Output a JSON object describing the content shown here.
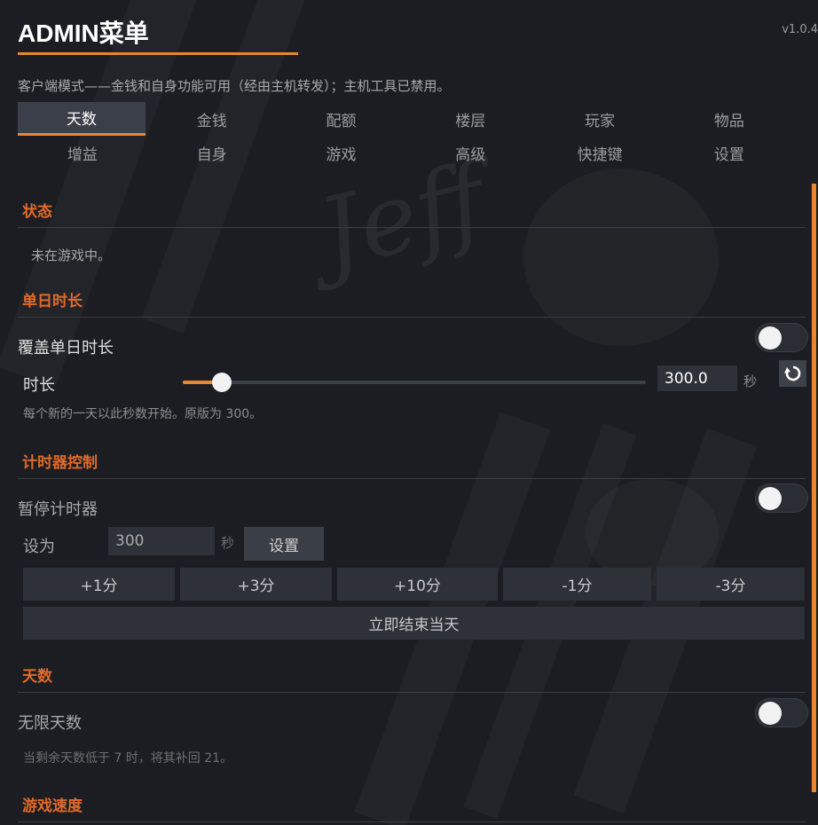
{
  "app": {
    "title": "ADMIN菜单",
    "version": "v1.0.4",
    "mode_text": "客户端模式——金钱和自身功能可用（经由主机转发）；主机工具已禁用。",
    "accent_color": "#e8872e",
    "section_color": "#e06a2a"
  },
  "tabs": [
    {
      "label": "天数",
      "active": true
    },
    {
      "label": "金钱",
      "active": false
    },
    {
      "label": "配额",
      "active": false
    },
    {
      "label": "楼层",
      "active": false
    },
    {
      "label": "玩家",
      "active": false
    },
    {
      "label": "物品",
      "active": false
    },
    {
      "label": "增益",
      "active": false
    },
    {
      "label": "自身",
      "active": false
    },
    {
      "label": "游戏",
      "active": false
    },
    {
      "label": "高级",
      "active": false
    },
    {
      "label": "快捷键",
      "active": false
    },
    {
      "label": "设置",
      "active": false
    }
  ],
  "status": {
    "heading": "状态",
    "text": "未在游戏中。"
  },
  "day_length": {
    "heading": "单日时长",
    "override_label": "覆盖单日时长",
    "override_on": false,
    "length_label": "时长",
    "slider_fraction": 0.085,
    "value": "300.0",
    "unit": "秒",
    "reset_icon": "refresh-icon",
    "hint": "每个新的一天以此秒数开始。原版为 300。"
  },
  "timer": {
    "heading": "计时器控制",
    "pause_label": "暂停计时器",
    "pause_on": false,
    "set_label": "设为",
    "set_value": "300",
    "set_unit": "秒",
    "set_button": "设置",
    "adjust_buttons": [
      "+1分",
      "+3分",
      "+10分",
      "-1分",
      "-3分"
    ],
    "end_day_button": "立即结束当天"
  },
  "days": {
    "heading": "天数",
    "infinite_label": "无限天数",
    "infinite_on": false,
    "hint": "当剩余天数低于 7 时，将其补回 21。"
  },
  "game_speed": {
    "heading": "游戏速度"
  }
}
